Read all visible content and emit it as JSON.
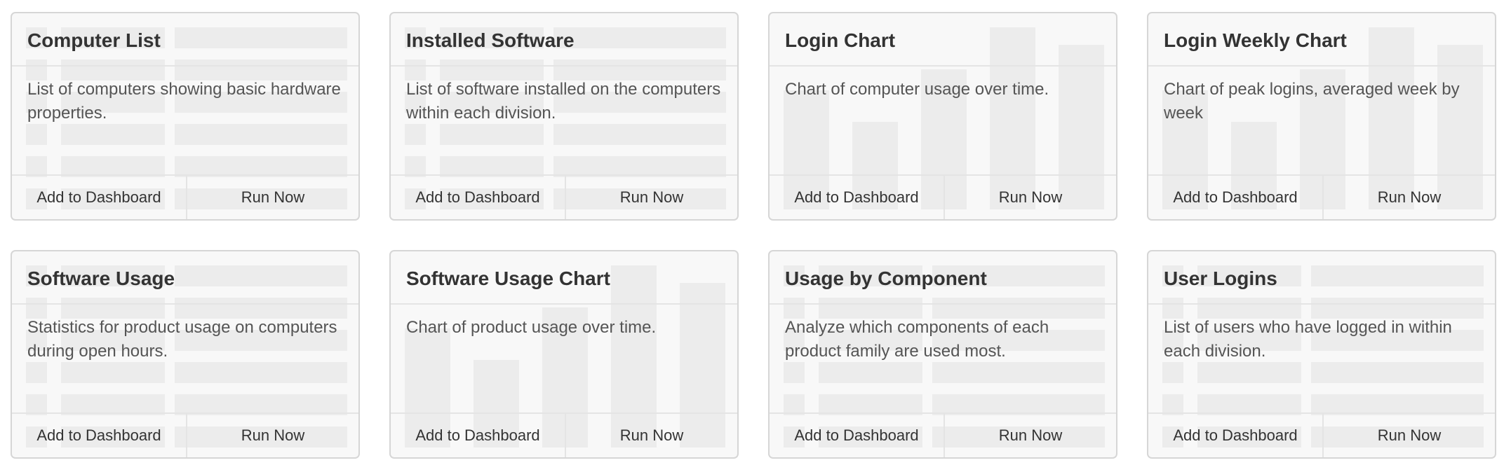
{
  "cards": [
    {
      "title": "Computer List",
      "description": "List of computers showing basic hardware properties.",
      "add_label": "Add to Dashboard",
      "run_label": "Run Now",
      "preview": "table"
    },
    {
      "title": "Installed Software",
      "description": "List of software installed on the computers within each division.",
      "add_label": "Add to Dashboard",
      "run_label": "Run Now",
      "preview": "table"
    },
    {
      "title": "Login Chart",
      "description": "Chart of computer usage over time.",
      "add_label": "Add to Dashboard",
      "run_label": "Run Now",
      "preview": "bar-chart"
    },
    {
      "title": "Login Weekly Chart",
      "description": "Chart of peak logins, averaged week by week",
      "add_label": "Add to Dashboard",
      "run_label": "Run Now",
      "preview": "bar-chart"
    },
    {
      "title": "Software Usage",
      "description": "Statistics for product usage on computers during open hours.",
      "add_label": "Add to Dashboard",
      "run_label": "Run Now",
      "preview": "table"
    },
    {
      "title": "Software Usage Chart",
      "description": "Chart of product usage over time.",
      "add_label": "Add to Dashboard",
      "run_label": "Run Now",
      "preview": "bar-chart"
    },
    {
      "title": "Usage by Component",
      "description": "Analyze which components of each product family are used most.",
      "add_label": "Add to Dashboard",
      "run_label": "Run Now",
      "preview": "table"
    },
    {
      "title": "User Logins",
      "description": "List of users who have logged in within each division.",
      "add_label": "Add to Dashboard",
      "run_label": "Run Now",
      "preview": "table"
    }
  ]
}
